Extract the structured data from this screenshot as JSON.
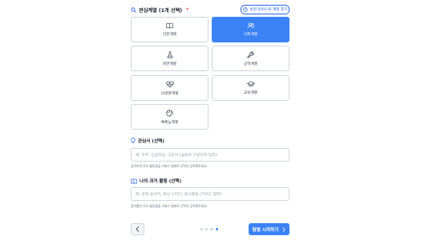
{
  "interest": {
    "title": "관심계열 (1개 선택)",
    "required_mark": "*",
    "help_button": "방향 분야으로 계열 찾기",
    "cards": [
      {
        "label": "인문계열",
        "icon": "book-icon"
      },
      {
        "label": "사회계열",
        "icon": "users-icon",
        "selected": true
      },
      {
        "label": "자연계열",
        "icon": "flask-icon"
      },
      {
        "label": "공학계열",
        "icon": "wrench-icon"
      },
      {
        "label": "의생명계열",
        "icon": "heart-pulse-icon"
      },
      {
        "label": "교육계열",
        "icon": "graduation-cap-icon"
      },
      {
        "label": "예체능계열",
        "icon": "palette-icon"
      }
    ]
  },
  "topic": {
    "title": "관심사 (선택)",
    "placeholder": "예: 우주, 인공지능, 고양이 (쉼표로 구분하여 입력)",
    "help": "입력하면 주요 활동들을 키워드 형태로 간략히 입력해주세요."
  },
  "activity": {
    "title": "나의 과거 활동 (선택)",
    "placeholder": "예: 과학 동아리, 토닝 스터디, 봉사활동 (키워드 형태)",
    "help": "참여했던 주요 활동들을 키워드 형태로 간략히 입력해주세요."
  },
  "footer": {
    "next_label": "탐험 시작하기",
    "steps_total": 4,
    "current_step": 4
  },
  "colors": {
    "accent": "#3b82f6",
    "required": "#ef4444"
  }
}
